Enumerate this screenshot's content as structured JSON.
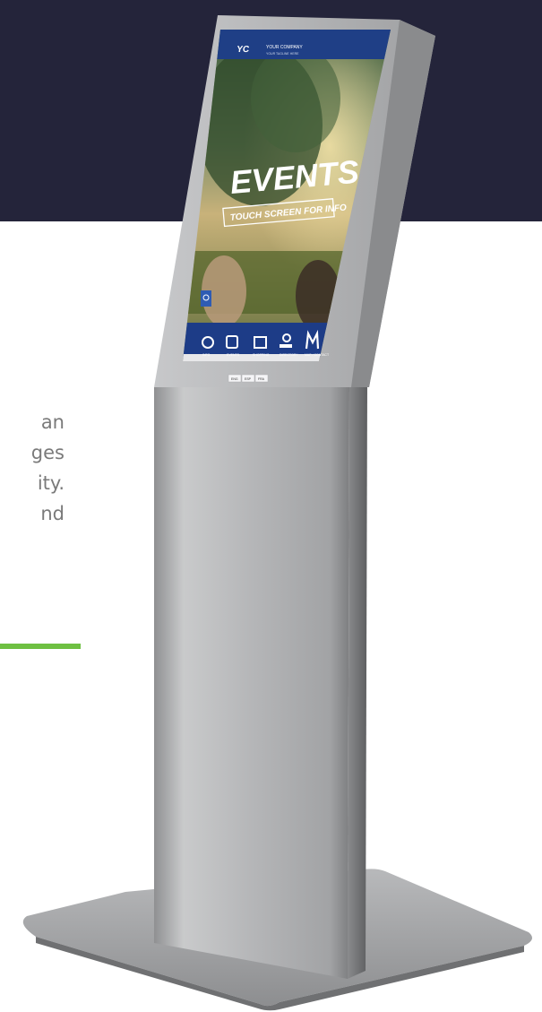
{
  "kiosk_screen": {
    "logo_mark": "YC",
    "company_name": "YOUR COMPANY",
    "company_tagline": "YOUR TAGLINE HERE",
    "headline": "EVENTS",
    "subheadline": "TOUCH SCREEN FOR INFO",
    "nav_items": [
      {
        "icon": "compass-icon",
        "label": "INFO"
      },
      {
        "icon": "calendar-icon",
        "label": "EVENTS"
      },
      {
        "icon": "store-icon",
        "label": "SHOPPING"
      },
      {
        "icon": "map-pin-icon",
        "label": "DIRECTORY"
      },
      {
        "icon": "m-logo-icon",
        "label": "MAP / CONTACT"
      }
    ],
    "language_buttons": [
      "ENG",
      "ESP",
      "FRA"
    ],
    "colors": {
      "screen_blue": "#1f3f86",
      "nav_blue": "#1d3c87"
    }
  },
  "page": {
    "text_fragments": [
      "an",
      "ges",
      "ity.",
      "nd"
    ],
    "colors": {
      "dark_band": "#24243a",
      "accent_green": "#6ec042",
      "body_text": "#7a7a7a"
    }
  }
}
